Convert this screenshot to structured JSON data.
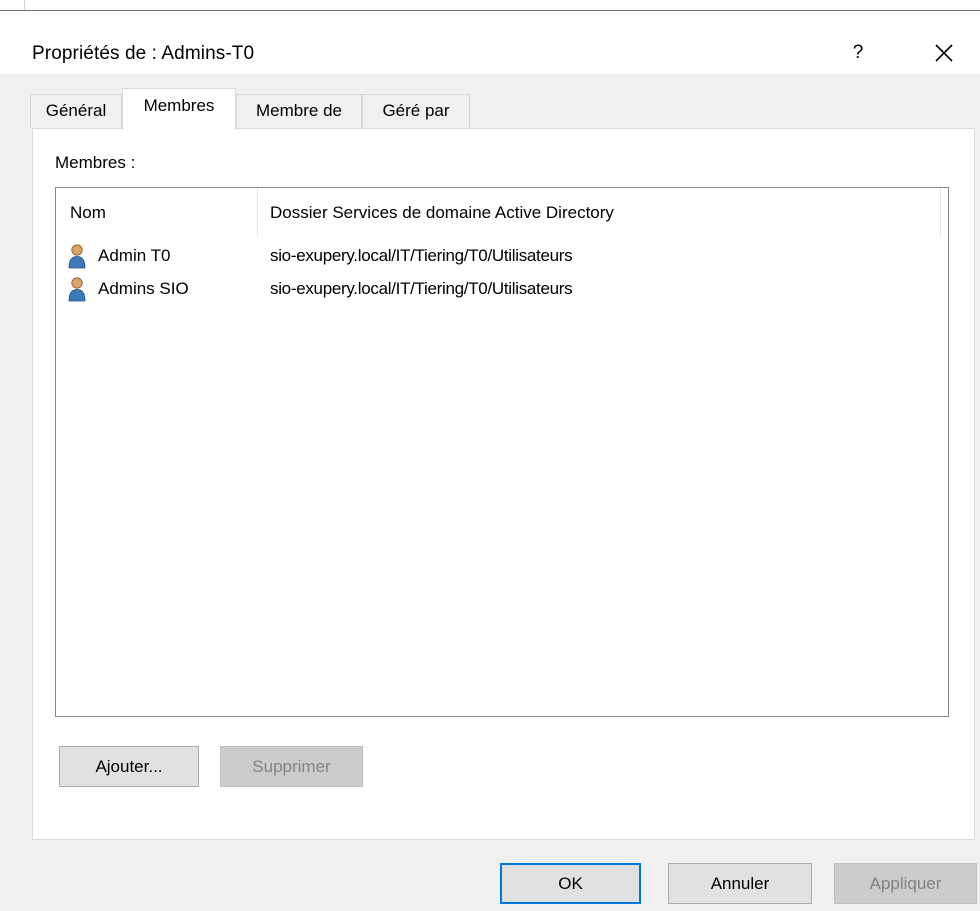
{
  "window": {
    "title": "Propriétés de : Admins-T0",
    "help_label": "?",
    "close_icon": "close-icon"
  },
  "tabs": [
    {
      "label": "Général",
      "active": false
    },
    {
      "label": "Membres",
      "active": true
    },
    {
      "label": "Membre de",
      "active": false
    },
    {
      "label": "Géré par",
      "active": false
    }
  ],
  "members": {
    "label": "Membres :",
    "columns": [
      "Nom",
      "Dossier Services de domaine Active Directory"
    ],
    "rows": [
      {
        "name": "Admin T0",
        "folder": "sio-exupery.local/IT/Tiering/T0/Utilisateurs",
        "icon": "user-icon"
      },
      {
        "name": "Admins SIO",
        "folder": "sio-exupery.local/IT/Tiering/T0/Utilisateurs",
        "icon": "user-icon"
      }
    ],
    "add_label": "Ajouter...",
    "remove_label": "Supprimer"
  },
  "footer": {
    "ok_label": "OK",
    "cancel_label": "Annuler",
    "apply_label": "Appliquer"
  },
  "colors": {
    "client_bg": "#f0f0f0",
    "focus_border": "#0078d7"
  }
}
